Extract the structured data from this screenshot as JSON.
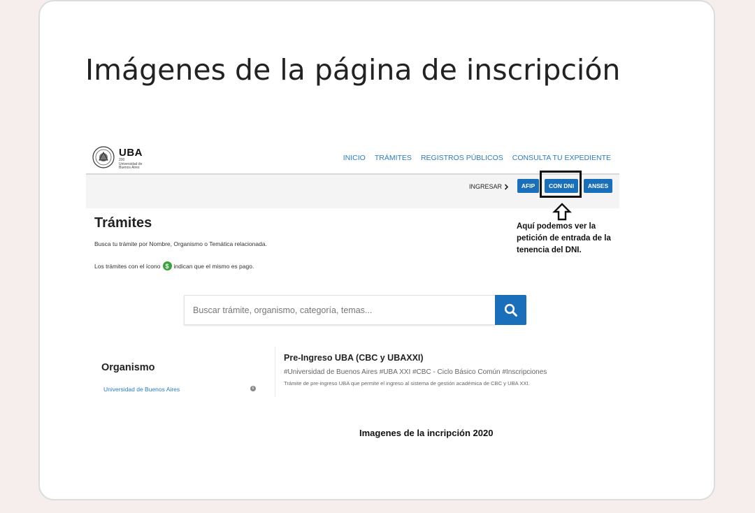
{
  "slide": {
    "title": "Imágenes de la página de inscripción",
    "caption": "Imagenes de la incripción 2020"
  },
  "site": {
    "logo_text": "UBA",
    "logo_subtext": "200 Universidad de Buenos Aires",
    "nav": [
      "INICIO",
      "TRÁMITES",
      "REGISTROS PÚBLICOS",
      "CONSULTA TU EXPEDIENTE"
    ],
    "login": {
      "ingresar_label": "INGRESAR",
      "buttons": [
        "AFIP",
        "CON DNI",
        "ANSES"
      ]
    },
    "annotation": "Aquí podemos ver la petición de entrada de la tenencia del DNI.",
    "tramites": {
      "title": "Trámites",
      "description": "Busca tu trámite por Nombre, Organismo o Temática relacionada.",
      "pago_before": "Los trámites con el ícono",
      "pago_after": "indican que el mismo es pago."
    },
    "search": {
      "placeholder": "Buscar trámite, organismo, categoría, temas..."
    },
    "sidebar": {
      "title": "Organismo",
      "item": "Universidad de Buenos Aires",
      "count": "6"
    },
    "result": {
      "title": "Pre-Ingreso UBA (CBC y UBAXXI)",
      "tags": "#Universidad de Buenos Aires #UBA XXI #CBC - Ciclo Básico Común #Inscripciones",
      "description": "Trámite de pre-ingreso UBA que permite el ingreso al sistema de gestión académica de CBC y UBA XXI."
    }
  },
  "colors": {
    "brand_blue": "#1a6fbb",
    "link_blue": "#2b7bbf",
    "pago_green": "#3aa23a"
  }
}
